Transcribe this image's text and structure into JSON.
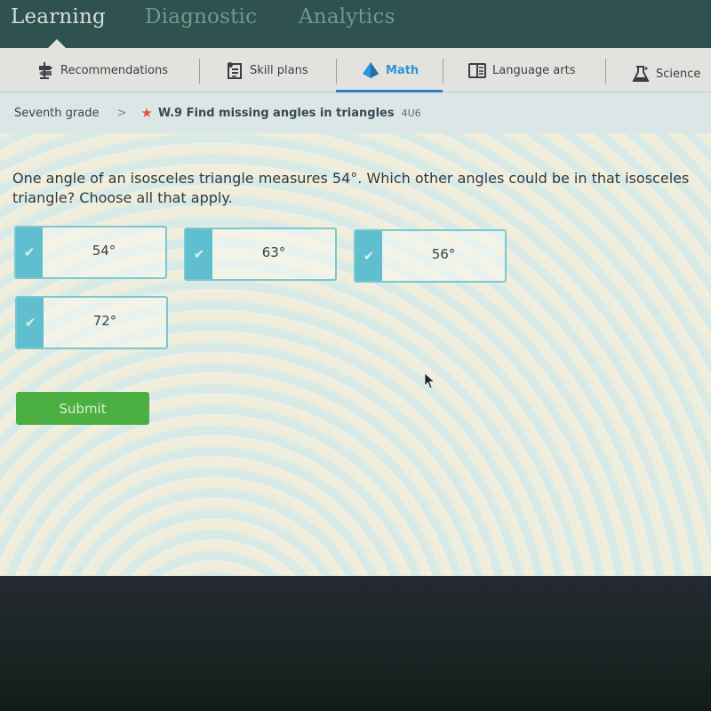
{
  "top_nav": {
    "tabs": [
      {
        "label": "Learning",
        "active": true
      },
      {
        "label": "Diagnostic",
        "active": false
      },
      {
        "label": "Analytics",
        "active": false
      }
    ]
  },
  "sub_nav": {
    "items": [
      {
        "label": "Recommendations",
        "icon": "signpost-icon",
        "active": false
      },
      {
        "label": "Skill plans",
        "icon": "skill-plan-icon",
        "active": false
      },
      {
        "label": "Math",
        "icon": "pyramid-icon",
        "active": true
      },
      {
        "label": "Language arts",
        "icon": "book-icon",
        "active": false
      },
      {
        "label": "Science",
        "icon": "flask-icon",
        "active": false
      }
    ],
    "active_color": "#2f93d6"
  },
  "breadcrumb": {
    "grade": "Seventh grade",
    "separator": ">",
    "star_icon": "star-icon",
    "skill": "W.9 Find missing angles in triangles",
    "code": "4U6"
  },
  "question": {
    "text": "One angle of an isosceles triangle measures 54°. Which other angles could be in that isosceles triangle? Choose all that apply."
  },
  "choices": [
    {
      "label": "54°",
      "icon": "checkmark-icon"
    },
    {
      "label": "63°",
      "icon": "checkmark-icon"
    },
    {
      "label": "56°",
      "icon": "checkmark-icon"
    },
    {
      "label": "72°",
      "icon": "checkmark-icon"
    }
  ],
  "submit": {
    "label": "Submit",
    "color": "#4caf42"
  },
  "colors": {
    "top_nav_bg": "#2f5150",
    "choice_border": "#7cc6cf",
    "choice_check_bg": "#5fbfcf",
    "star": "#e8573a"
  }
}
